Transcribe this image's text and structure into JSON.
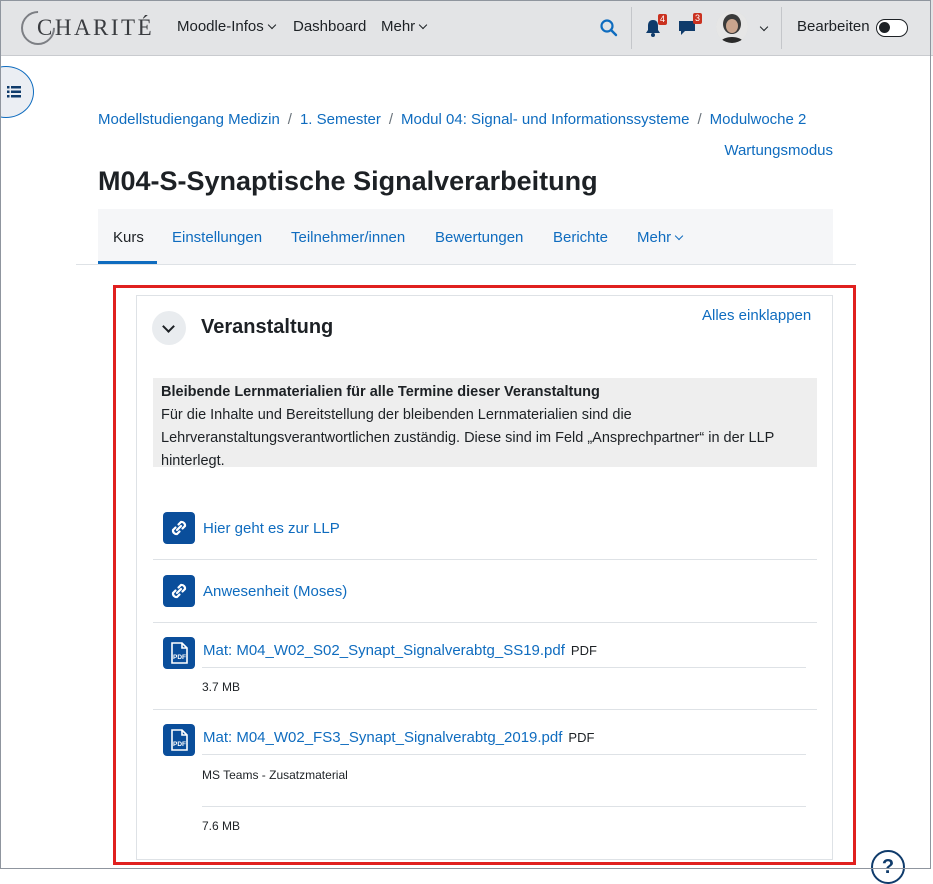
{
  "navbar": {
    "logo_text": "CHARITÉ",
    "items": [
      {
        "label": "Moodle-Infos"
      },
      {
        "label": "Dashboard"
      },
      {
        "label": "Mehr"
      }
    ],
    "notifications_count": "4",
    "messages_count": "3",
    "edit_label": "Bearbeiten"
  },
  "breadcrumb": [
    "Modellstudiengang Medizin",
    "1. Semester",
    "Modul 04: Signal- und Informationssysteme",
    "Modulwoche 2"
  ],
  "maintenance_link": "Wartungsmodus",
  "page_title": "M04-S-Synaptische Signalverarbeitung",
  "secondary_nav": {
    "items": [
      "Kurs",
      "Einstellungen",
      "Teilnehmer/innen",
      "Bewertungen",
      "Berichte",
      "Mehr"
    ],
    "active": "Kurs"
  },
  "section": {
    "title": "Veranstaltung",
    "collapse_all": "Alles einklappen",
    "summary_heading": "Bleibende Lernmaterialien für alle Termine dieser Veranstaltung",
    "summary_text": "Für die Inhalte und Bereitstellung der bleibenden Lernmaterialien sind die Lehrveranstaltungsverantwortlichen zuständig. Diese sind im Feld „Ansprechpartner“ in der LLP hinterlegt.",
    "activities": [
      {
        "name": "Hier geht es zur LLP",
        "icon": "link-icon"
      },
      {
        "name": "Anwesenheit (Moses)",
        "icon": "link-icon"
      },
      {
        "name": "Mat: M04_W02_S02_Synapt_Signalverabtg_SS19.pdf",
        "type": "PDF",
        "icon": "pdf-icon",
        "size": "3.7 MB"
      },
      {
        "name": "Mat: M04_W02_FS3_Synapt_Signalverabtg_2019.pdf",
        "type": "PDF",
        "icon": "pdf-icon",
        "description": "MS Teams - Zusatzmaterial",
        "size": "7.6 MB"
      }
    ]
  },
  "help_label": "?",
  "colors": {
    "link": "#0f6cbf",
    "icon_bg": "#0a4e9b",
    "highlight": "#e0201f",
    "badge": "#ca3120"
  }
}
